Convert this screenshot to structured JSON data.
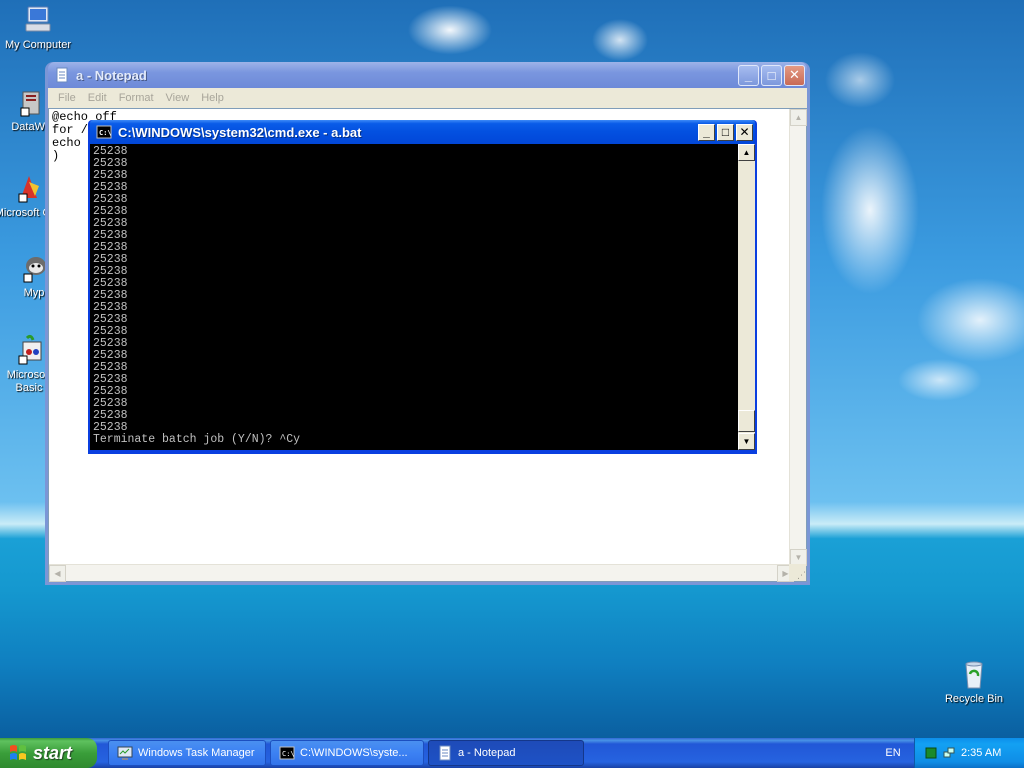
{
  "desktop": {
    "icons": [
      {
        "label": "My Computer",
        "icon": "my-computer-icon"
      },
      {
        "label": "DataWa",
        "icon": "datawarehouse-shortcut-icon"
      },
      {
        "label": "Microsoft C++",
        "icon": "visual-cpp-shortcut-icon"
      },
      {
        "label": "Myp",
        "icon": "mypal-shortcut-icon"
      },
      {
        "label": "Microsoft Basic",
        "icon": "visual-basic-shortcut-icon"
      },
      {
        "label": "Recycle Bin",
        "icon": "recycle-bin-icon"
      }
    ]
  },
  "notepad": {
    "title": "a - Notepad",
    "menu": [
      "File",
      "Edit",
      "Format",
      "View",
      "Help"
    ],
    "content": "@echo off\nfor /\necho\n)"
  },
  "cmd": {
    "title": "C:\\WINDOWS\\system32\\cmd.exe - a.bat",
    "output_line": "25238",
    "output_repeat": 24,
    "last_line": "Terminate batch job (Y/N)? ^Cy"
  },
  "taskbar": {
    "start_label": "start",
    "tasks": [
      {
        "label": "Windows Task Manager",
        "icon": "task-manager-icon"
      },
      {
        "label": "C:\\WINDOWS\\syste...",
        "icon": "cmd-icon"
      },
      {
        "label": "a - Notepad",
        "icon": "notepad-icon"
      }
    ],
    "language": "EN",
    "clock": "2:35 AM"
  },
  "colors": {
    "xp_blue": "#0831d9",
    "cmd_text": "#c0c0c0",
    "start_green": "#3a9e3a"
  }
}
